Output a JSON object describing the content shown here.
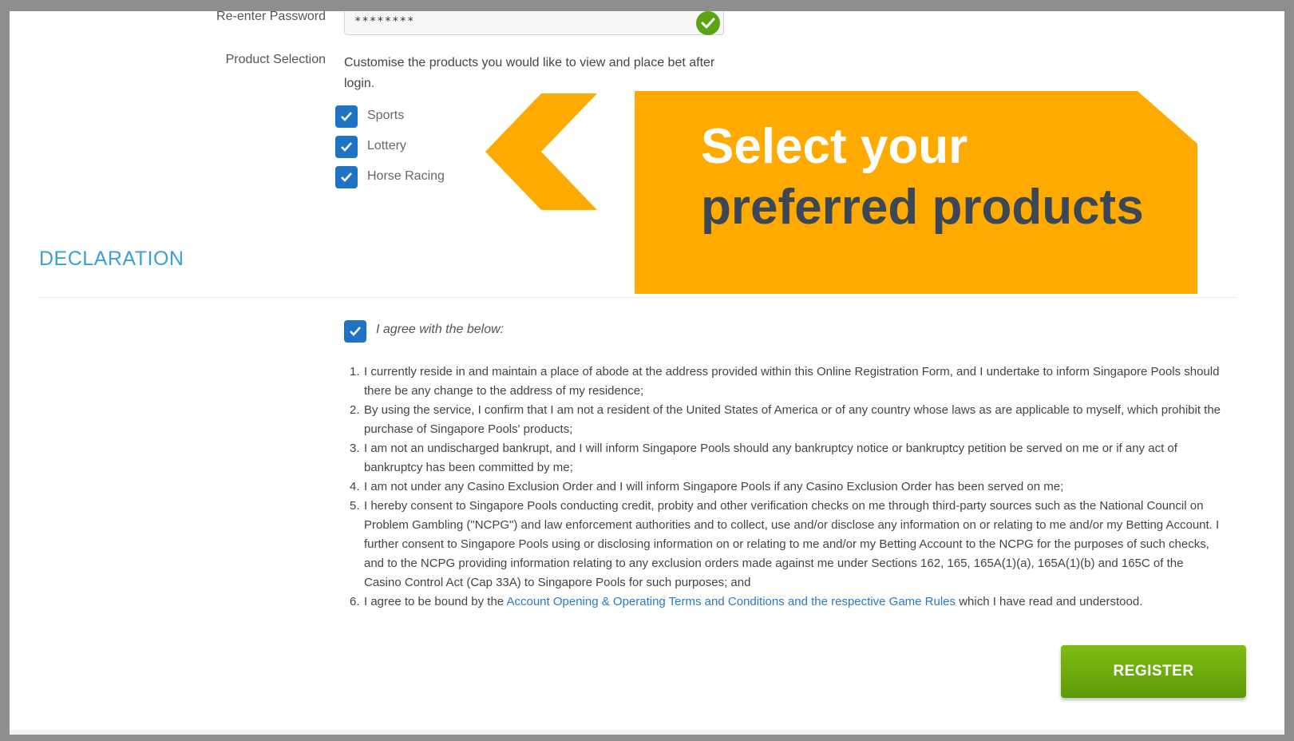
{
  "form": {
    "reenter_password_label": "Re-enter Password",
    "reenter_password_value": "********",
    "product_selection_label": "Product Selection",
    "product_selection_desc": "Customise the products you would like to view and place bet after login.",
    "products": [
      {
        "label": "Sports",
        "checked": true
      },
      {
        "label": "Lottery",
        "checked": true
      },
      {
        "label": "Horse Racing",
        "checked": true
      }
    ]
  },
  "banner": {
    "line1": "Select your",
    "line2": "preferred products",
    "color": "#ffaa00"
  },
  "declaration": {
    "title": "DECLARATION",
    "agree_label": "I agree with the below:",
    "agree_checked": true,
    "items": [
      {
        "num": "1.",
        "text": "I currently reside in and maintain a place of abode at the address provided within this Online Registration Form, and I undertake to inform Singapore Pools should there be any change to the address of my residence;"
      },
      {
        "num": "2.",
        "text": "By using the service, I confirm that I am not a resident of the United States of America or of any country whose laws as are applicable to myself, which prohibit the purchase of Singapore Pools' products;"
      },
      {
        "num": "3.",
        "text": "I am not an undischarged bankrupt, and I will inform Singapore Pools should any bankruptcy notice or bankruptcy petition be served on me or if any act of bankruptcy has been committed by me;"
      },
      {
        "num": "4.",
        "text": "I am not under any Casino Exclusion Order and I will inform Singapore Pools if any Casino Exclusion Order has been served on me;"
      },
      {
        "num": "5.",
        "text": "I hereby consent to Singapore Pools conducting credit, probity and other verification checks on me through third-party sources such as the National Council on Problem Gambling (\"NCPG\") and law enforcement authorities and to collect, use and/or disclose any information on or relating to me and/or my Betting Account. I further consent to Singapore Pools using or disclosing information on or relating to me and/or my Betting Account to the NCPG for the purposes of such checks, and to the NCPG providing information relating to any exclusion orders made against me under Sections 162, 165, 165A(1)(a), 165A(1)(b) and 165C of the Casino Control Act (Cap 33A) to Singapore Pools for such purposes; and"
      },
      {
        "num": "6.",
        "text_before": "I agree to be bound by the ",
        "link": "Account Opening & Operating Terms and Conditions and the respective Game Rules",
        "text_after": " which I have read and understood."
      }
    ]
  },
  "register_button": "REGISTER",
  "colors": {
    "accent_blue": "#1f73c5",
    "title_blue": "#3aa0d8",
    "register_green": "#6aab0c"
  }
}
